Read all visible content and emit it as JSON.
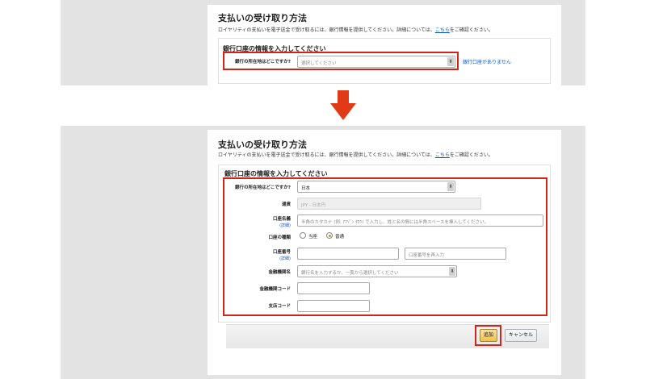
{
  "top": {
    "title": "支払いの受け取り方法",
    "description_pre": "ロイヤリティの支払いを電子送金で受け取るには、銀行情報を提供してください。詳細については、",
    "description_link": "こちら",
    "description_post": "をご確認ください。",
    "section_title": "銀行口座の情報を入力してください",
    "country_label": "銀行の所在地はどこですか?",
    "country_placeholder": "選択してください",
    "no_account_link": "銀行口座がありません"
  },
  "bottom": {
    "title": "支払いの受け取り方法",
    "description_pre": "ロイヤリティの支払いを電子送金で受け取るには、銀行情報を提供してください。詳細については、",
    "description_link": "こちら",
    "description_post": "をご確認ください。",
    "section_title": "銀行口座の情報を入力してください",
    "country_label": "銀行の所在地はどこですか?",
    "country_value": "日本",
    "currency_label": "通貨",
    "currency_value": "JPY - 日本円",
    "holder_label": "口座名義",
    "details_label": "(詳細)",
    "holder_placeholder": "半角のカタカナ (例: ｱﾏｿﾞﾝ ﾀﾛｳ) で入力し、姓と名の間には半角スペースを挿入してください。",
    "account_type_label": "口座の種類",
    "account_type_options": [
      "当座",
      "普通"
    ],
    "account_type_selected": "普通",
    "account_number_label": "口座番号",
    "account_number_confirm_placeholder": "口座番号を再入力",
    "bank_name_label": "金融機関名",
    "bank_name_placeholder": "銀行名を入力するか、一覧から選択してください",
    "bank_code_label": "金融機関コード",
    "branch_code_label": "支店コード",
    "add_button": "追加",
    "cancel_button": "キャンセル"
  },
  "colors": {
    "highlight": "#d0261a",
    "link": "#0a57c2",
    "radio_checked": "#e08a00"
  },
  "icons": {
    "arrow": "down-arrow-icon",
    "select": "select-arrow-icon"
  }
}
